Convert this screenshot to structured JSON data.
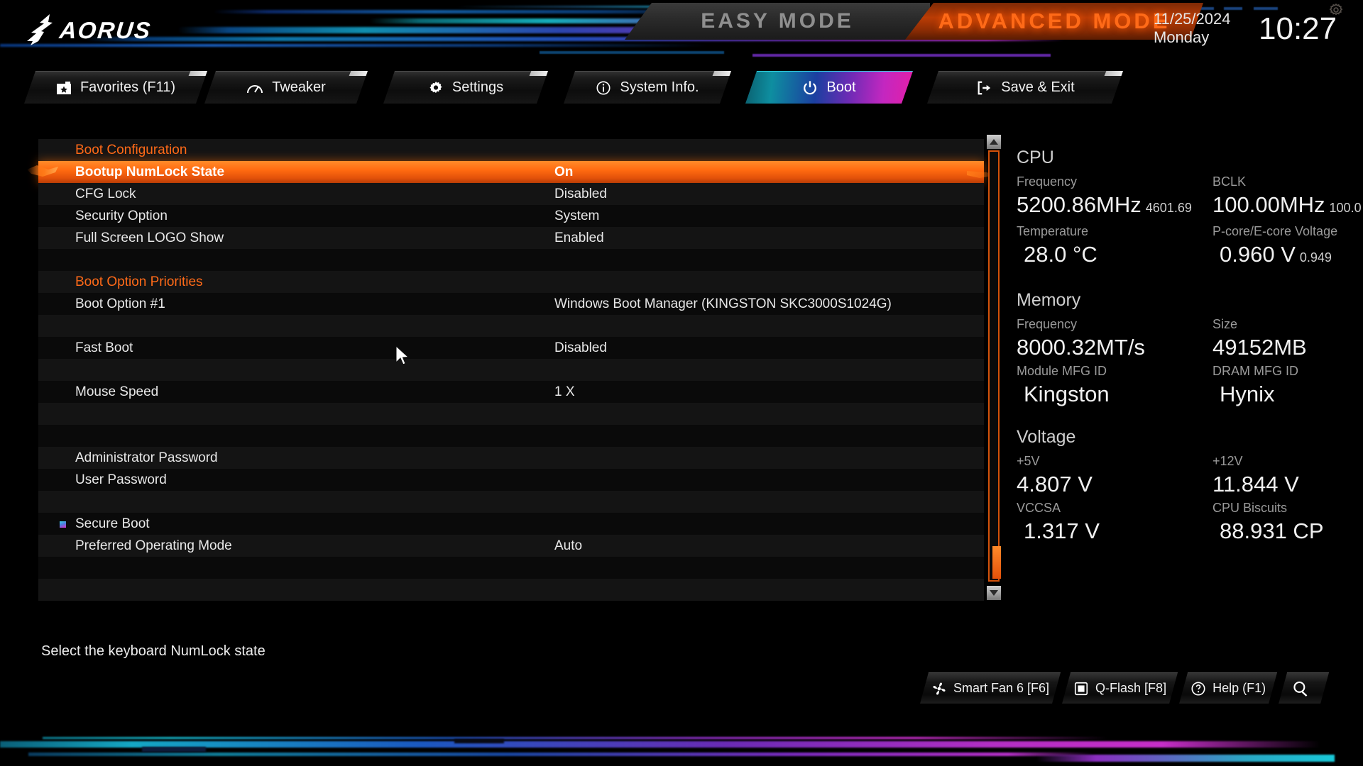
{
  "header": {
    "brand": "AORUS",
    "easy_mode_label": "EASY MODE",
    "advanced_mode_label": "ADVANCED MODE",
    "date": "11/25/2024",
    "weekday": "Monday",
    "time": "10:27",
    "gear_icon": "gear-icon"
  },
  "nav": {
    "tabs": [
      {
        "label": "Favorites (F11)",
        "icon": "star-favorites-icon",
        "active": false
      },
      {
        "label": "Tweaker",
        "icon": "gauge-icon",
        "active": false
      },
      {
        "label": "Settings",
        "icon": "gear-icon",
        "active": false
      },
      {
        "label": "System Info.",
        "icon": "info-circle-icon",
        "active": false
      },
      {
        "label": "Boot",
        "icon": "power-icon",
        "active": true
      },
      {
        "label": "Save & Exit",
        "icon": "exit-arrow-icon",
        "active": false
      }
    ]
  },
  "settings_list": [
    {
      "type": "header",
      "name": "Boot Configuration",
      "value": ""
    },
    {
      "type": "item",
      "name": "Bootup NumLock State",
      "value": "On",
      "selected": true
    },
    {
      "type": "item",
      "name": "CFG Lock",
      "value": "Disabled"
    },
    {
      "type": "item",
      "name": "Security Option",
      "value": "System"
    },
    {
      "type": "item",
      "name": "Full Screen LOGO Show",
      "value": "Enabled"
    },
    {
      "type": "spacer",
      "name": "",
      "value": ""
    },
    {
      "type": "header",
      "name": "Boot Option Priorities",
      "value": ""
    },
    {
      "type": "item",
      "name": "Boot Option #1",
      "value": "Windows Boot Manager (KINGSTON SKC3000S1024G)"
    },
    {
      "type": "spacer",
      "name": "",
      "value": ""
    },
    {
      "type": "item",
      "name": "Fast Boot",
      "value": "Disabled"
    },
    {
      "type": "spacer",
      "name": "",
      "value": ""
    },
    {
      "type": "item",
      "name": "Mouse Speed",
      "value": "1 X"
    },
    {
      "type": "spacer",
      "name": "",
      "value": ""
    },
    {
      "type": "spacer",
      "name": "",
      "value": ""
    },
    {
      "type": "item",
      "name": "Administrator Password",
      "value": ""
    },
    {
      "type": "item",
      "name": "User Password",
      "value": ""
    },
    {
      "type": "spacer",
      "name": "",
      "value": ""
    },
    {
      "type": "submenu",
      "name": "Secure Boot",
      "value": ""
    },
    {
      "type": "item",
      "name": "Preferred Operating Mode",
      "value": "Auto"
    },
    {
      "type": "spacer",
      "name": "",
      "value": ""
    },
    {
      "type": "spacer",
      "name": "",
      "value": ""
    }
  ],
  "scrollbar": {
    "up_icon": "caret-up-icon",
    "down_icon": "caret-down-icon"
  },
  "info_panel": {
    "sections": [
      {
        "title": "CPU",
        "entries": [
          {
            "label": "Frequency",
            "value": "5200.86MHz",
            "sub": "4601.69"
          },
          {
            "label": "BCLK",
            "value": "100.00MHz",
            "sub": "100.0"
          },
          {
            "label": "Temperature",
            "value": "28.0 °C",
            "sub": ""
          },
          {
            "label": "P-core/E-core Voltage",
            "value": "0.960 V",
            "sub": "0.949"
          }
        ]
      },
      {
        "title": "Memory",
        "entries": [
          {
            "label": "Frequency",
            "value": "8000.32MT/s",
            "sub": ""
          },
          {
            "label": "Size",
            "value": "49152MB",
            "sub": ""
          },
          {
            "label": "Module MFG ID",
            "value": "Kingston",
            "sub": ""
          },
          {
            "label": "DRAM MFG ID",
            "value": "Hynix",
            "sub": ""
          }
        ]
      },
      {
        "title": "Voltage",
        "entries": [
          {
            "label": "+5V",
            "value": "4.807 V",
            "sub": ""
          },
          {
            "label": "+12V",
            "value": "11.844 V",
            "sub": ""
          },
          {
            "label": "VCCSA",
            "value": "1.317 V",
            "sub": ""
          },
          {
            "label": "CPU Biscuits",
            "value": "88.931 CP",
            "sub": ""
          }
        ]
      }
    ]
  },
  "footer": {
    "help_text": "Select the keyboard NumLock state",
    "buttons": [
      {
        "label": "Smart Fan 6 [F6]",
        "icon": "fan-icon"
      },
      {
        "label": "Q-Flash [F8]",
        "icon": "chip-icon"
      },
      {
        "label": "Help (F1)",
        "icon": "question-circle-icon"
      },
      {
        "label": "",
        "icon": "search-icon"
      }
    ]
  },
  "colors": {
    "accent_orange": "#ff6a18",
    "selected_row": "#ff6a10",
    "active_tab_cyan": "#0e8ea0",
    "active_tab_magenta": "#e41fa8",
    "panel_bg": "#000000"
  }
}
